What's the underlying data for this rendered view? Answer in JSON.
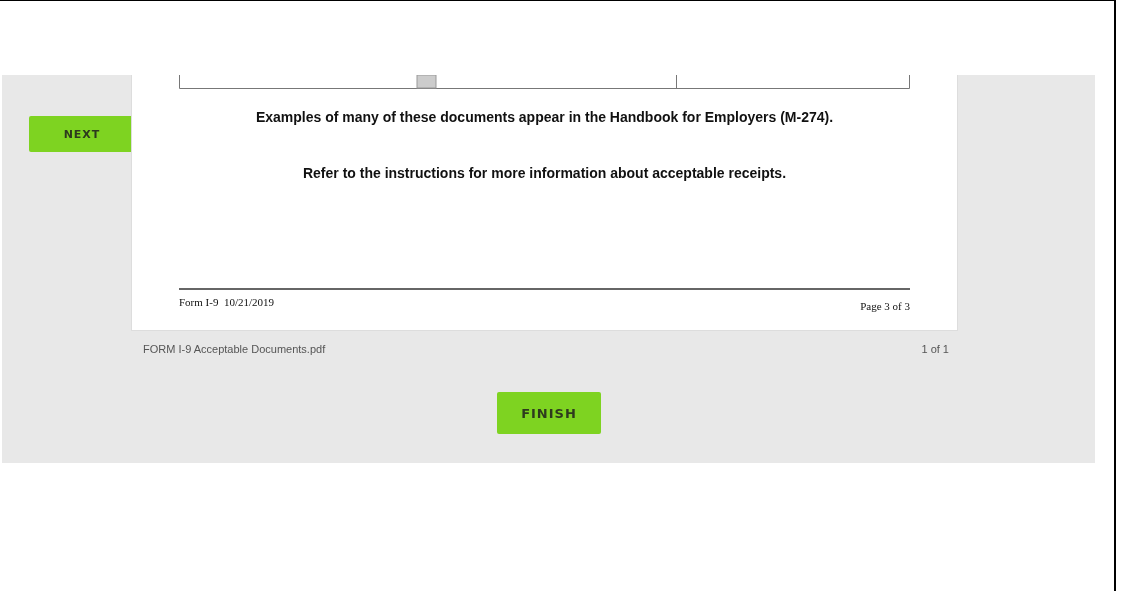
{
  "next_button": {
    "label": "NEXT"
  },
  "document": {
    "notes": [
      "Examples of many of these documents appear in the Handbook for Employers (M-274).",
      "Refer to the instructions for more information about acceptable receipts."
    ],
    "footer_left": "Form I-9  10/21/2019",
    "footer_right": "Page 3 of 3"
  },
  "viewer_footer": {
    "file_name": "FORM I-9 Acceptable Documents.pdf",
    "page_count": "1 of 1"
  },
  "finish_button": {
    "label": "FINISH"
  }
}
